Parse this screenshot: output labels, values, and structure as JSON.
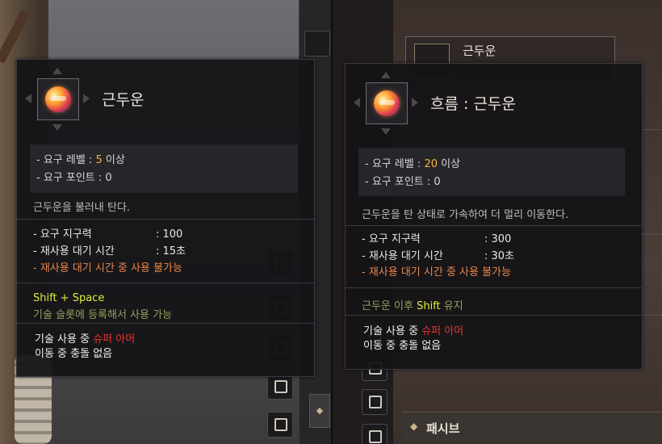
{
  "left": {
    "tooltip": {
      "title": "근두운",
      "req_level_prefix": "- 요구 레벨 : ",
      "req_level_value": "5",
      "req_level_suffix": " 이상",
      "req_points": "- 요구 포인트 : 0",
      "description": "근두운을 불러내 탄다.",
      "stamina_label": "- 요구 지구력",
      "stamina_value": ": 100",
      "cooldown_label": "- 재사용 대기 시간",
      "cooldown_value": ": 15초",
      "cooldown_warning": "- 재사용 대기 시간 중 사용 불가능",
      "key_command": "Shift + Space",
      "key_note": "기술 슬롯에 등록해서 사용 가능",
      "super_armor_prefix": "기술 사용 중 ",
      "super_armor_value": "슈퍼 아머",
      "collision": "이동 중 충돌 없음"
    }
  },
  "right": {
    "header_title": "근두운",
    "bg_item_text": "이동",
    "passive_label": "패시브",
    "tooltip": {
      "title": "흐름 : 근두운",
      "req_level_prefix": "- 요구 레벨 : ",
      "req_level_value": "20",
      "req_level_suffix": " 이상",
      "req_points": "- 요구 포인트 : 0",
      "description": "근두운을 탄 상태로 가속하여 더 멀리 이동한다.",
      "stamina_label": "- 요구 지구력",
      "stamina_value": ": 300",
      "cooldown_label": "- 재사용 대기 시간",
      "cooldown_value": ": 30초",
      "cooldown_warning": "- 재사용 대기 시간 중 사용 불가능",
      "status_prefix": "근두운 이후 ",
      "status_key": "Shift",
      "status_suffix": " 유지",
      "super_armor_prefix": "기술 사용 중 ",
      "super_armor_value": "슈퍼 아머",
      "collision": "이동 중 충돌 없음"
    }
  },
  "colors": {
    "level_highlight": "#f0b33a",
    "warning": "#e8874a",
    "key_yellow": "#e2ee3c",
    "super_armor_red": "#e8322e"
  },
  "icons": [
    "skill-cloud-icon",
    "lock-icon",
    "diamond-icon"
  ]
}
